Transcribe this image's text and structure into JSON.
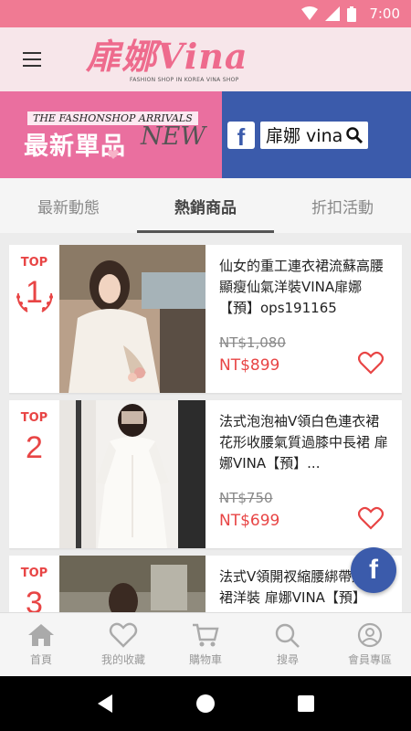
{
  "status_bar": {
    "time": "7:00"
  },
  "header": {
    "brand_name": "扉娜Vina",
    "brand_tagline": "FASHION SHOP IN KOREA  VINA SHOP"
  },
  "banner": {
    "arrivals_text": "THE FASHONSHOP ARRIVALS",
    "new_items_text": "最新單品",
    "new_text": "NEW",
    "facebook_search_text": "扉娜 vina"
  },
  "tabs": [
    {
      "label": "最新動態",
      "active": false
    },
    {
      "label": "熱銷商品",
      "active": true
    },
    {
      "label": "折扣活動",
      "active": false
    }
  ],
  "products": [
    {
      "rank_label": "TOP",
      "rank": "1",
      "title": "仙女的重工連衣裙流蘇高腰顯瘦仙氣洋裝VINA扉娜【預】ops191165",
      "original_price": "NT$1,080",
      "price": "NT$899"
    },
    {
      "rank_label": "TOP",
      "rank": "2",
      "title": "法式泡泡袖V領白色連衣裙花形收腰氣質過膝中長裙 扉娜VINA【預】...",
      "original_price": "NT$750",
      "price": "NT$699"
    },
    {
      "rank_label": "TOP",
      "rank": "3",
      "title": "法式V領開衩縮腰綁帶連身裙洋裝 扉娜VINA【預】",
      "original_price": "",
      "price": ""
    }
  ],
  "fab": {
    "label": "f"
  },
  "bottom_nav": [
    {
      "label": "首頁",
      "icon": "home-icon"
    },
    {
      "label": "我的收藏",
      "icon": "heart-icon"
    },
    {
      "label": "購物車",
      "icon": "cart-icon"
    },
    {
      "label": "搜尋",
      "icon": "search-icon"
    },
    {
      "label": "會員專區",
      "icon": "account-icon"
    }
  ],
  "colors": {
    "status_bar": "#f07a93",
    "header_bg": "#f7e6ea",
    "brand": "#ee6b8d",
    "banner_pink": "#ea6f9f",
    "facebook_blue": "#3b5bab",
    "price_red": "#e84545"
  }
}
